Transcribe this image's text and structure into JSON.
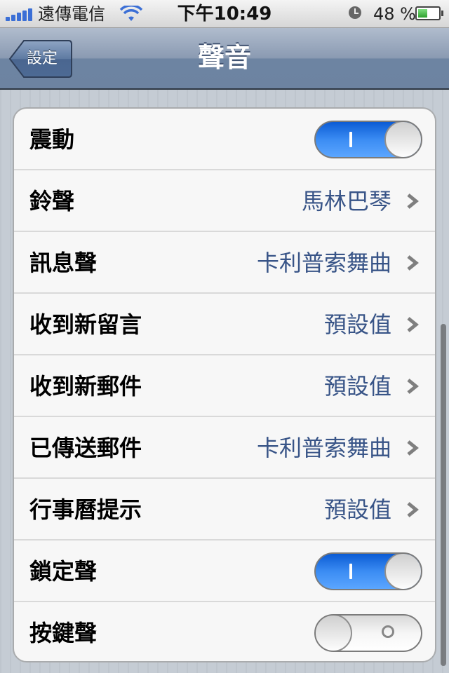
{
  "status_bar": {
    "carrier": "遠傳電信",
    "time": "下午10:49",
    "battery_percent": "48 %",
    "battery_level": 0.48,
    "icons": [
      "signal-icon",
      "wifi-icon",
      "clock-icon",
      "battery-icon"
    ]
  },
  "nav": {
    "back_label": "設定",
    "title": "聲音"
  },
  "settings": {
    "rows": [
      {
        "label": "震動",
        "type": "toggle",
        "on": true,
        "toggle_text": "I"
      },
      {
        "label": "鈴聲",
        "type": "value",
        "value": "馬林巴琴"
      },
      {
        "label": "訊息聲",
        "type": "value",
        "value": "卡利普索舞曲"
      },
      {
        "label": "收到新留言",
        "type": "value",
        "value": "預設值"
      },
      {
        "label": "收到新郵件",
        "type": "value",
        "value": "預設值"
      },
      {
        "label": "已傳送郵件",
        "type": "value",
        "value": "卡利普索舞曲"
      },
      {
        "label": "行事曆提示",
        "type": "value",
        "value": "預設值"
      },
      {
        "label": "鎖定聲",
        "type": "toggle",
        "on": true,
        "toggle_text": "I"
      },
      {
        "label": "按鍵聲",
        "type": "toggle",
        "on": false,
        "toggle_text": "O"
      }
    ]
  },
  "colors": {
    "accent_blue": "#3b8cf3",
    "value_text": "#385487",
    "nav_bar": "#6d84a2"
  }
}
